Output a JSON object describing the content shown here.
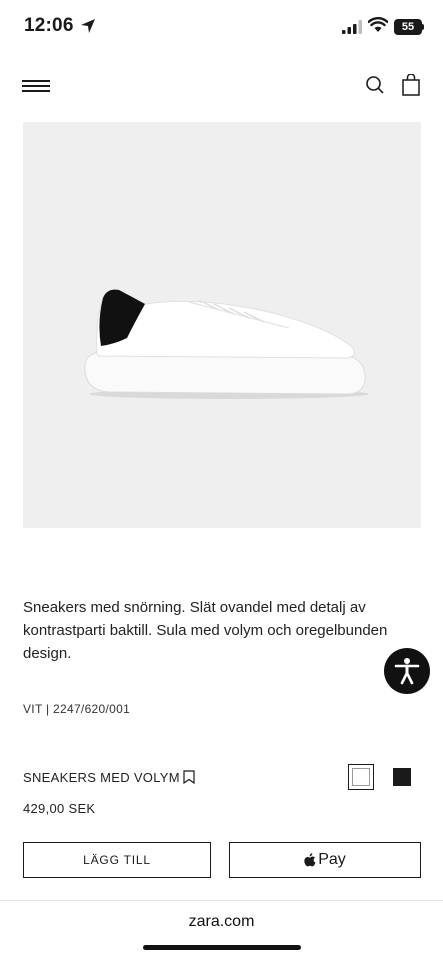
{
  "status_bar": {
    "time": "12:06",
    "battery_level": "55"
  },
  "product": {
    "description": "Sneakers med snörning. Slät ovandel med detalj av kontrastparti baktill. Sula med volym och oregelbunden design.",
    "reference": "VIT | 2247/620/001",
    "name": "SNEAKERS MED VOLYM",
    "price": "429,00 SEK",
    "colors": [
      {
        "name": "white",
        "hex": "#ffffff",
        "selected": true
      },
      {
        "name": "black",
        "hex": "#1a1a1a",
        "selected": false
      }
    ]
  },
  "actions": {
    "add_label": "LÄGG TILL",
    "pay_label": "Pay"
  },
  "browser": {
    "url": "zara.com"
  },
  "colors": {
    "image_bg": "#efefef",
    "text": "#1a1a1a"
  }
}
